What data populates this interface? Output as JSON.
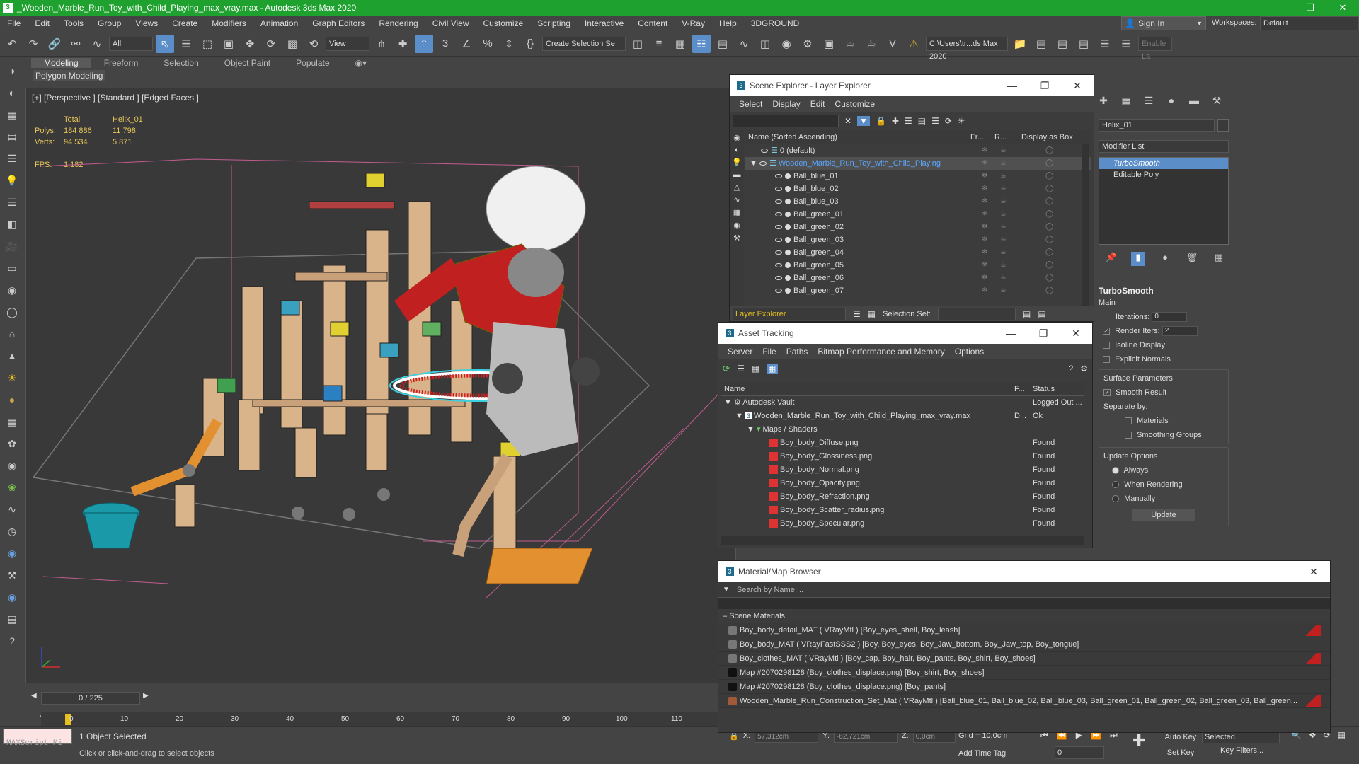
{
  "app": {
    "title": "_Wooden_Marble_Run_Toy_with_Child_Playing_max_vray.max - Autodesk 3ds Max 2020",
    "logo": "3",
    "window_controls": [
      "—",
      "❐",
      "✕"
    ]
  },
  "menu": [
    "File",
    "Edit",
    "Tools",
    "Group",
    "Views",
    "Create",
    "Modifiers",
    "Animation",
    "Graph Editors",
    "Rendering",
    "Civil View",
    "Customize",
    "Scripting",
    "Interactive",
    "Content",
    "V-Ray",
    "Help",
    "3DGROUND"
  ],
  "account": {
    "sign_in": "Sign In",
    "workspaces_label": "Workspaces:",
    "workspace": "Default"
  },
  "toolbar": {
    "filter": "All",
    "view": "View",
    "selection_set": "Create Selection Se",
    "path": "C:\\Users\\tr...ds Max 2020",
    "enable_label": "Enable La"
  },
  "ribbon": {
    "tabs": [
      "Modeling",
      "Freeform",
      "Selection",
      "Object Paint",
      "Populate"
    ],
    "active_tab": "Modeling",
    "panel": "Polygon Modeling"
  },
  "viewport": {
    "label": "[+] [Perspective ] [Standard ] [Edged Faces ]",
    "stats": {
      "col_total": "Total",
      "col_obj": "Helix_01",
      "polys_label": "Polys:",
      "polys_total": "184 886",
      "polys_obj": "11 798",
      "verts_label": "Verts:",
      "verts_total": "94 534",
      "verts_obj": "5 871",
      "fps_label": "FPS:",
      "fps": "1,182"
    }
  },
  "scene_explorer": {
    "title": "Scene Explorer - Layer Explorer",
    "menu": [
      "Select",
      "Display",
      "Edit",
      "Customize"
    ],
    "columns": [
      "Name (Sorted Ascending)",
      "Fr...",
      "R...",
      "Display as Box"
    ],
    "rows": [
      {
        "name": "0 (default)",
        "indent": 0
      },
      {
        "name": "Wooden_Marble_Run_Toy_with_Child_Playing",
        "indent": 0,
        "selected": true
      },
      {
        "name": "Ball_blue_01",
        "indent": 1
      },
      {
        "name": "Ball_blue_02",
        "indent": 1
      },
      {
        "name": "Ball_blue_03",
        "indent": 1
      },
      {
        "name": "Ball_green_01",
        "indent": 1
      },
      {
        "name": "Ball_green_02",
        "indent": 1
      },
      {
        "name": "Ball_green_03",
        "indent": 1
      },
      {
        "name": "Ball_green_04",
        "indent": 1
      },
      {
        "name": "Ball_green_05",
        "indent": 1
      },
      {
        "name": "Ball_green_06",
        "indent": 1
      },
      {
        "name": "Ball_green_07",
        "indent": 1
      }
    ],
    "footer_explorer": "Layer Explorer",
    "selection_set_label": "Selection Set:"
  },
  "asset_tracking": {
    "title": "Asset Tracking",
    "menu": [
      "Server",
      "File",
      "Paths",
      "Bitmap Performance and Memory",
      "Options"
    ],
    "columns": [
      "Name",
      "F...",
      "Status"
    ],
    "rows": [
      {
        "name": "Autodesk Vault",
        "f": "",
        "status": "Logged Out ...",
        "indent": 0
      },
      {
        "name": "Wooden_Marble_Run_Toy_with_Child_Playing_max_vray.max",
        "f": "D...",
        "status": "Ok",
        "indent": 1
      },
      {
        "name": "Maps / Shaders",
        "f": "",
        "status": "",
        "indent": 2
      },
      {
        "name": "Boy_body_Diffuse.png",
        "f": "",
        "status": "Found",
        "indent": 3
      },
      {
        "name": "Boy_body_Glossiness.png",
        "f": "",
        "status": "Found",
        "indent": 3
      },
      {
        "name": "Boy_body_Normal.png",
        "f": "",
        "status": "Found",
        "indent": 3
      },
      {
        "name": "Boy_body_Opacity.png",
        "f": "",
        "status": "Found",
        "indent": 3
      },
      {
        "name": "Boy_body_Refraction.png",
        "f": "",
        "status": "Found",
        "indent": 3
      },
      {
        "name": "Boy_body_Scatter_radius.png",
        "f": "",
        "status": "Found",
        "indent": 3
      },
      {
        "name": "Boy_body_Specular.png",
        "f": "",
        "status": "Found",
        "indent": 3
      }
    ]
  },
  "material_browser": {
    "title": "Material/Map Browser",
    "search_placeholder": "Search by Name ...",
    "section": "Scene Materials",
    "items": [
      "Boy_body_detail_MAT ( VRayMtl ) [Boy_eyes_shell, Boy_leash]",
      "Boy_body_MAT ( VRayFastSSS2 ) [Boy, Boy_eyes, Boy_Jaw_bottom, Boy_Jaw_top, Boy_tongue]",
      "Boy_clothes_MAT ( VRayMtl ) [Boy_cap, Boy_hair, Boy_pants, Boy_shirt, Boy_shoes]",
      "Map #2070298128 (Boy_clothes_displace.png) [Boy_shirt, Boy_shoes]",
      "Map #2070298128 (Boy_clothes_displace.png) [Boy_pants]",
      "Wooden_Marble_Run_Construction_Set_Mat ( VRayMtl ) [Ball_blue_01, Ball_blue_02, Ball_blue_03, Ball_green_01, Ball_green_02, Ball_green_03, Ball_green..."
    ]
  },
  "command_panel": {
    "object_name": "Helix_01",
    "modifier_list": "Modifier List",
    "stack": [
      "TurboSmooth",
      "Editable Poly"
    ],
    "turbosmooth": {
      "title": "TurboSmooth",
      "main": "Main",
      "iterations_label": "Iterations:",
      "iterations": "0",
      "render_iters_label": "Render Iters:",
      "render_iters": "2",
      "isoline": "Isoline Display",
      "explicit": "Explicit Normals",
      "surface_params": "Surface Parameters",
      "smooth_result": "Smooth Result",
      "separate_by": "Separate by:",
      "materials": "Materials",
      "smoothing_groups": "Smoothing Groups",
      "update_options": "Update Options",
      "always": "Always",
      "when_rendering": "When Rendering",
      "manually": "Manually",
      "update": "Update"
    }
  },
  "timeline": {
    "frame": "0 / 225",
    "ticks": [
      "0",
      "10",
      "20",
      "30",
      "40",
      "50",
      "60",
      "70",
      "80",
      "90",
      "100",
      "110"
    ]
  },
  "status": {
    "maxscript": "MAXScript Mi",
    "objects_selected": "1 Object Selected",
    "hint": "Click or click-and-drag to select objects",
    "x_label": "X:",
    "x": "57,312cm",
    "y_label": "Y:",
    "y": "-62,721cm",
    "z_label": "Z:",
    "z": "0,0cm",
    "grid": "Grid = 10,0cm",
    "add_time_tag": "Add Time Tag",
    "auto_key": "Auto Key",
    "set_key": "Set Key",
    "selected": "Selected",
    "key_filters": "Key Filters...",
    "frame_value": "0"
  }
}
